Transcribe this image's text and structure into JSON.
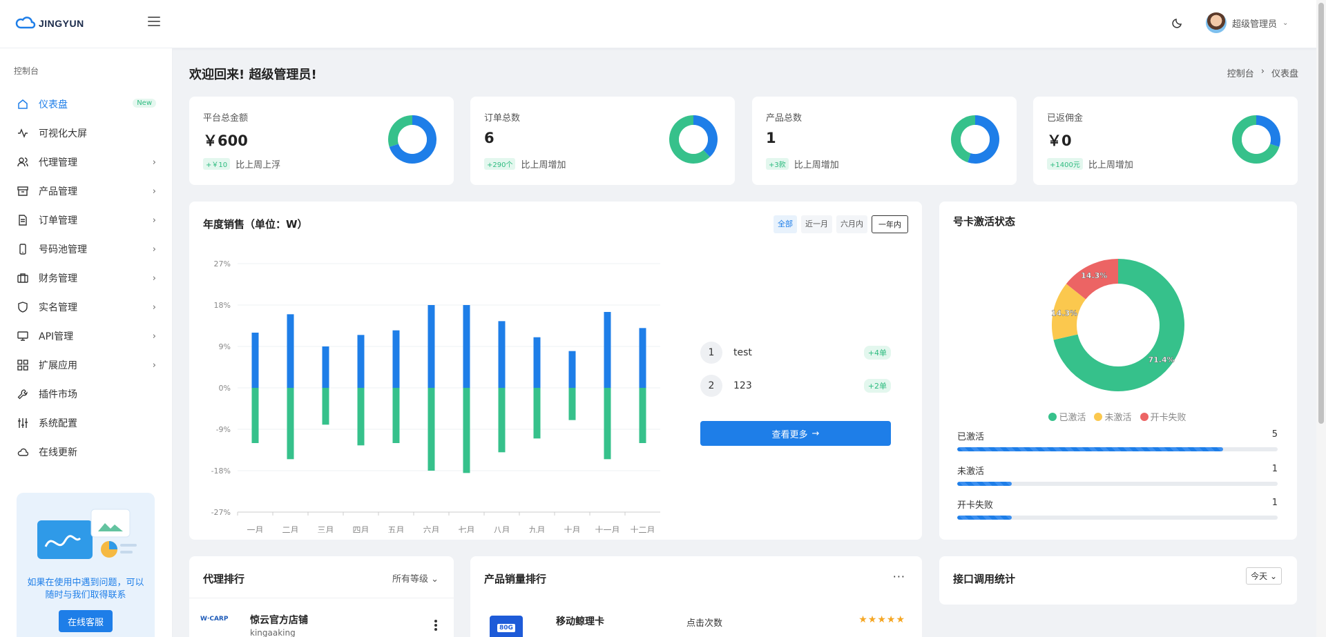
{
  "app": {
    "logo_text": "JINGYUN"
  },
  "header": {
    "user_name": "超级管理员",
    "user_caret": "⌄"
  },
  "sidebar": {
    "section_title": "控制台",
    "items": [
      {
        "label": "仪表盘",
        "icon": "home-icon",
        "badge": "New",
        "active": true
      },
      {
        "label": "可视化大屏",
        "icon": "activity-icon"
      },
      {
        "label": "代理管理",
        "icon": "users-icon",
        "chevron": "›"
      },
      {
        "label": "产品管理",
        "icon": "archive-icon",
        "chevron": "›"
      },
      {
        "label": "订单管理",
        "icon": "file-icon",
        "chevron": "›"
      },
      {
        "label": "号码池管理",
        "icon": "phone-icon",
        "chevron": "›"
      },
      {
        "label": "财务管理",
        "icon": "briefcase-icon",
        "chevron": "›"
      },
      {
        "label": "实名管理",
        "icon": "shield-icon",
        "chevron": "›"
      },
      {
        "label": "API管理",
        "icon": "monitor-icon",
        "chevron": "›"
      },
      {
        "label": "扩展应用",
        "icon": "grid-icon",
        "chevron": "›"
      },
      {
        "label": "插件市场",
        "icon": "wrench-icon"
      },
      {
        "label": "系统配置",
        "icon": "sliders-icon"
      },
      {
        "label": "在线更新",
        "icon": "cloud-icon"
      }
    ],
    "help": {
      "text": "如果在使用中遇到问题，可以随时与我们取得联系",
      "button": "在线客服"
    }
  },
  "main": {
    "welcome": "欢迎回来! 超级管理员!",
    "breadcrumb": [
      "控制台",
      "›",
      "仪表盘"
    ],
    "stats": [
      {
        "label": "平台总金额",
        "value": "￥600",
        "delta": "+￥10",
        "delta_text": "比上周上浮",
        "ring_pct": 0.7
      },
      {
        "label": "订单总数",
        "value": "6",
        "delta": "+290个",
        "delta_text": "比上周增加",
        "ring_pct": 0.38
      },
      {
        "label": "产品总数",
        "value": "1",
        "delta": "+3款",
        "delta_text": "比上周增加",
        "ring_pct": 0.55
      },
      {
        "label": "已返佣金",
        "value": "￥0",
        "delta": "+1400元",
        "delta_text": "比上周增加",
        "ring_pct": 0.3
      }
    ],
    "sales": {
      "title": "年度销售（单位：W）",
      "ranges": [
        "全部",
        "近一月",
        "六月内",
        "一年内"
      ],
      "ranking": [
        {
          "rank": "1",
          "name": "test",
          "badge": "+4单"
        },
        {
          "rank": "2",
          "name": "123",
          "badge": "+2单"
        }
      ],
      "more_button": "查看更多"
    },
    "activation": {
      "title": "号卡激活状态",
      "legend": [
        "已激活",
        "未激活",
        "开卡失败"
      ],
      "slice_labels": [
        "71.4%",
        "14.3%",
        "14.3%"
      ],
      "rows": [
        {
          "label": "已激活",
          "count": "5",
          "fill": 0.83
        },
        {
          "label": "未激活",
          "count": "1",
          "fill": 0.17
        },
        {
          "label": "开卡失败",
          "count": "1",
          "fill": 0.17
        }
      ]
    },
    "agent_rank": {
      "title": "代理排行",
      "filter": "所有等级 ⌄",
      "row_name": "惊云官方店铺",
      "row_sub": "kingaaking",
      "row_logo": "W·CARP"
    },
    "product_rank": {
      "title": "产品销量排行",
      "more": "···",
      "row_name": "移动鲸理卡",
      "row_metric": "点击次数",
      "row_stars": "★★★★★",
      "row_chip": "80G"
    },
    "api_stats": {
      "title": "接口调用统计",
      "select": "今天"
    }
  },
  "colors": {
    "primary": "#1e7ee8",
    "green": "#36c18b",
    "yellow": "#fbc84e",
    "red": "#ec6464"
  },
  "chart_data": {
    "type": "bar",
    "categories": [
      "一月",
      "二月",
      "三月",
      "四月",
      "五月",
      "六月",
      "七月",
      "八月",
      "九月",
      "十月",
      "十一月",
      "十二月"
    ],
    "series": [
      {
        "values": [
          12,
          16,
          9,
          11.5,
          12.5,
          18,
          18,
          14.5,
          11,
          8,
          16.5,
          13
        ]
      },
      {
        "values": [
          -12,
          -15.5,
          -8,
          -12.5,
          -12,
          -18,
          -18.5,
          -14,
          -11,
          -7,
          -15.5,
          -12
        ]
      }
    ],
    "y_ticks": [
      "27%",
      "18%",
      "9%",
      "0%",
      "-9%",
      "-18%",
      "-27%"
    ],
    "ylim": [
      -27,
      27
    ]
  },
  "activation_chart": {
    "type": "pie",
    "labels": [
      "已激活",
      "未激活",
      "开卡失败"
    ],
    "values": [
      71.4,
      14.3,
      14.3
    ]
  }
}
